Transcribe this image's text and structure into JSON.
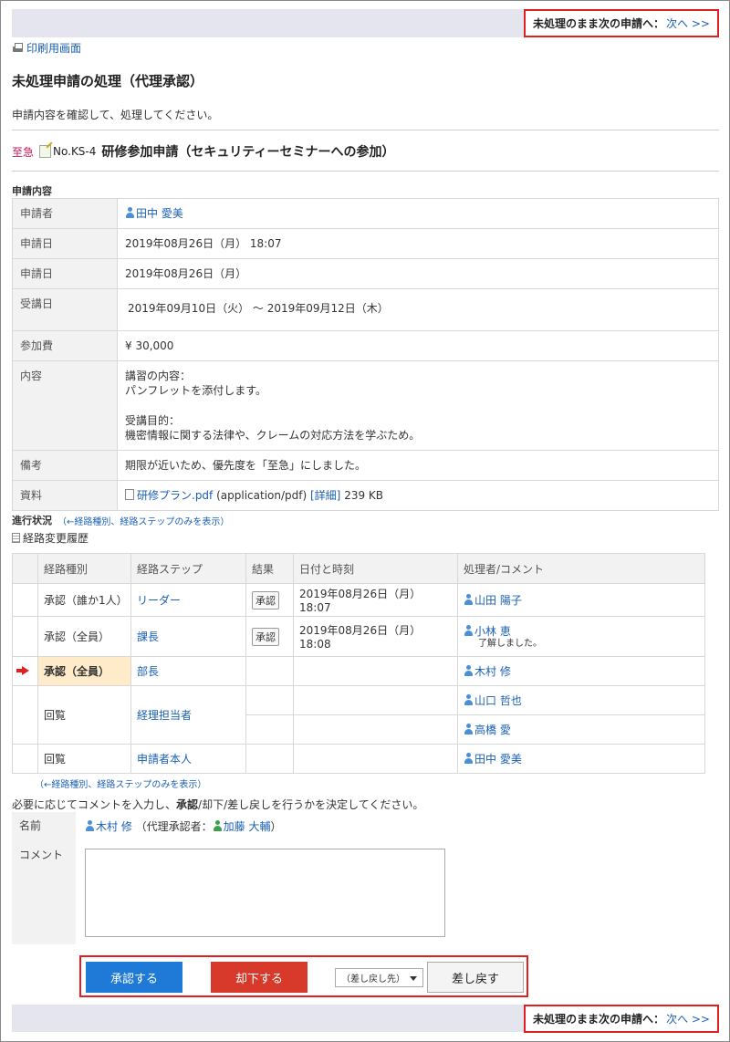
{
  "nav": {
    "next_label": "未処理のまま次の申請へ：",
    "next_link": "次へ >>"
  },
  "print_link": "印刷用画面",
  "page_title": "未処理申請の処理（代理承認）",
  "lead_text": "申請内容を確認して、処理してください。",
  "application": {
    "priority": "至急",
    "number": "No.KS-4",
    "title": "研修参加申請（セキュリティーセミナーへの参加）"
  },
  "details": {
    "section_label": "申請内容",
    "rows": [
      {
        "label": "申請者",
        "value": "田中 愛美"
      },
      {
        "label": "申請日",
        "value": "2019年08月26日（月） 18:07"
      },
      {
        "label": "申請日",
        "value": "2019年08月26日（月）"
      },
      {
        "label": "受講日",
        "value": "2019年09月10日（火） ～ 2019年09月12日（木）"
      },
      {
        "label": "参加費",
        "value": "¥ 30,000"
      },
      {
        "label": "内容",
        "line1": "講習の内容：",
        "line2": "パンフレットを添付します。",
        "line3": "受講目的：",
        "line4": "機密情報に関する法律や、クレームの対応方法を学ぶため。"
      },
      {
        "label": "備考",
        "value": "期限が近いため、優先度を「至急」にしました。"
      },
      {
        "label": "資料",
        "file": "研修プラン.pdf",
        "mime": "(application/pdf)",
        "detail_link": "[詳細]",
        "size": "239 KB"
      }
    ]
  },
  "progress": {
    "label": "進行状況",
    "toggle_link": "（←経路種別、経路ステップのみを表示）",
    "history_link": "経路変更履歴",
    "headers": [
      "経路種別",
      "経路ステップ",
      "結果",
      "日付と時刻",
      "処理者/コメント"
    ],
    "rows": [
      {
        "type": "承認（誰か1人）",
        "step": "リーダー",
        "result": "承認",
        "datetime": "2019年08月26日（月） 18:07",
        "user": "山田 陽子"
      },
      {
        "type": "承認（全員）",
        "step": "課長",
        "result": "承認",
        "datetime": "2019年08月26日（月） 18:08",
        "user": "小林 恵",
        "comment": "了解しました。"
      },
      {
        "type": "承認（全員）",
        "step": "部長",
        "user": "木村 修"
      },
      {
        "type": "回覧",
        "step": "経理担当者",
        "user": "山口 哲也",
        "user2": "高橋 愛"
      },
      {
        "type": "回覧",
        "step": "申請者本人",
        "user": "田中 愛美"
      }
    ],
    "toggle_link_bottom": "（←経路種別、経路ステップのみを表示）"
  },
  "form": {
    "instruction": "必要に応じてコメントを入力し、承認/却下/差し戻しを行うかを決定してください。",
    "instruction_a": "必要に応じてコメントを入力し、",
    "instruction_b": "承認",
    "instruction_c": "/却下/差し戻しを行うかを決定してください。",
    "name_label": "名前",
    "name_user": "木村 修",
    "proxy_prefix": "（代理承認者：",
    "proxy_user": "加藤 大輔",
    "proxy_suffix": "）",
    "comment_label": "コメント",
    "comment_value": ""
  },
  "actions": {
    "approve": "承認する",
    "reject": "却下する",
    "sendback_select": "（差し戻し先）",
    "sendback": "差し戻す"
  },
  "colors": {
    "accent": "#1e7ad6",
    "reject": "#d73a2a",
    "highlight": "#e02020",
    "current_step": "#ffebc9",
    "bar": "#e4e5ef"
  }
}
